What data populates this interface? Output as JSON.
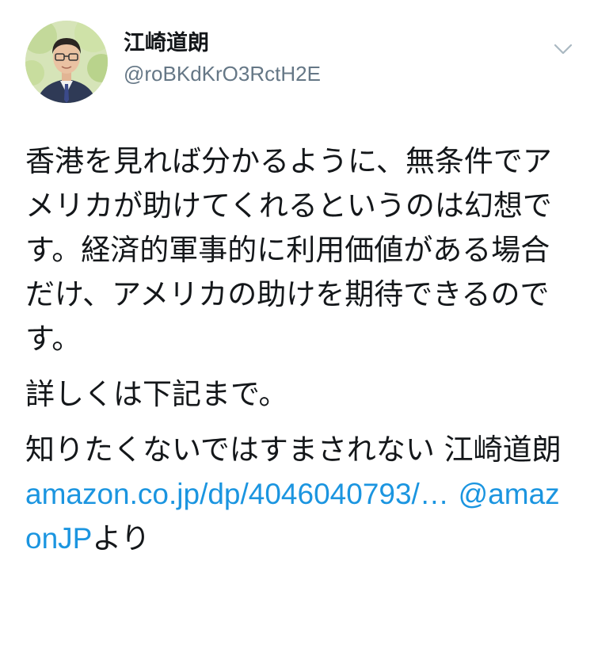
{
  "author": {
    "display_name": "江崎道朗",
    "handle": "@roBKdKrO3RctH2E"
  },
  "tweet": {
    "paragraph1": "香港を見れば分かるように、無条件でアメリカが助けてくれるというのは幻想です。経済的軍事的に利用価値がある場合だけ、アメリカの助けを期待できるのです。",
    "paragraph2": "詳しくは下記まで。",
    "paragraph3_text": "知りたくないではすまされない 江崎道朗 ",
    "link_text": "amazon.co.jp/dp/4046040793/…",
    "space": " ",
    "mention": "@amazonJP",
    "suffix": "より"
  },
  "icons": {
    "avatar": "profile-photo",
    "caret": "chevron-down-icon"
  },
  "colors": {
    "link": "#1b95e0",
    "handle": "#657786",
    "text": "#14171a"
  }
}
